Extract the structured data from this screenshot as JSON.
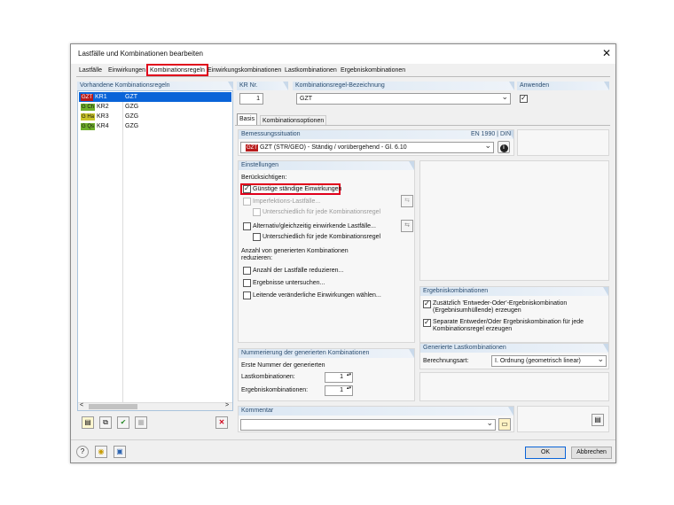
{
  "window": {
    "title": "Lastfälle und Kombinationen bearbeiten",
    "close": "✕"
  },
  "tabs": [
    "Lastfälle",
    "Einwirkungen",
    "Kombinationsregeln",
    "Einwirkungskombinationen",
    "Lastkombinationen",
    "Ergebniskombinationen"
  ],
  "left": {
    "header": "Vorhandene Kombinationsregeln",
    "rows": [
      {
        "tag": "GZT",
        "id": "KR1",
        "name": "GZT"
      },
      {
        "tag": "G Ch",
        "id": "KR2",
        "name": "GZG"
      },
      {
        "tag": "G Ha",
        "id": "KR3",
        "name": "GZG"
      },
      {
        "tag": "G Qs",
        "id": "KR4",
        "name": "GZG"
      }
    ],
    "scroll_left": "<",
    "scroll_right": ">"
  },
  "kr": {
    "label": "KR Nr.",
    "value": "1"
  },
  "bez": {
    "label": "Kombinationsregel-Bezeichnung",
    "value": "GZT"
  },
  "anwenden": {
    "label": "Anwenden"
  },
  "subtabs": [
    "Basis",
    "Kombinationsoptionen"
  ],
  "bemessung": {
    "label": "Bemessungssituation",
    "norm": "EN 1990 | DIN",
    "tag": "GZT",
    "value": "GZT (STR/GEO) - Ständig / vorübergehend - Gl. 6.10"
  },
  "einstellungen": {
    "label": "Einstellungen",
    "beruecksichtigen": "Berücksichtigen:",
    "guenstige": "Günstige ständige Einwirkungen",
    "imperfektion": "Imperfektions-Lastfälle...",
    "unterschiedlich1": "Unterschiedlich für jede Kombinationsregel",
    "alternativ": "Alternativ/gleichzeitig einwirkende Lastfälle...",
    "unterschiedlich2": "Unterschiedlich für jede Kombinationsregel",
    "anzahl_title1": "Anzahl von generierten Kombinationen",
    "anzahl_title2": "reduzieren:",
    "anzahl_lf": "Anzahl der Lastfälle reduzieren...",
    "ergebnisse": "Ergebnisse untersuchen...",
    "leitende": "Leitende veränderliche Einwirkungen wählen..."
  },
  "ergebnisk": {
    "label": "Ergebniskombinationen",
    "zusaetzlich1": "Zusätzlich 'Entweder-Oder'-Ergebniskombination",
    "zusaetzlich2": "(Ergebnisumhüllende) erzeugen",
    "separate1": "Separate Entweder/Oder Ergebniskombination für jede",
    "separate2": "Kombinationsregel  erzeugen"
  },
  "nummerierung": {
    "label": "Nummerierung der generierten Kombinationen",
    "erste": "Erste Nummer der generierten",
    "lk_label": "Lastkombinationen:",
    "lk_value": "1",
    "ek_label": "Ergebniskombinationen:",
    "ek_value": "1"
  },
  "generiert": {
    "label": "Generierte Lastkombinationen",
    "art_label": "Berechnungsart:",
    "art_value": "I. Ordnung (geometrisch linear)"
  },
  "kommentar": {
    "label": "Kommentar",
    "value": ""
  },
  "buttons": {
    "ok": "OK",
    "cancel": "Abbrechen"
  }
}
